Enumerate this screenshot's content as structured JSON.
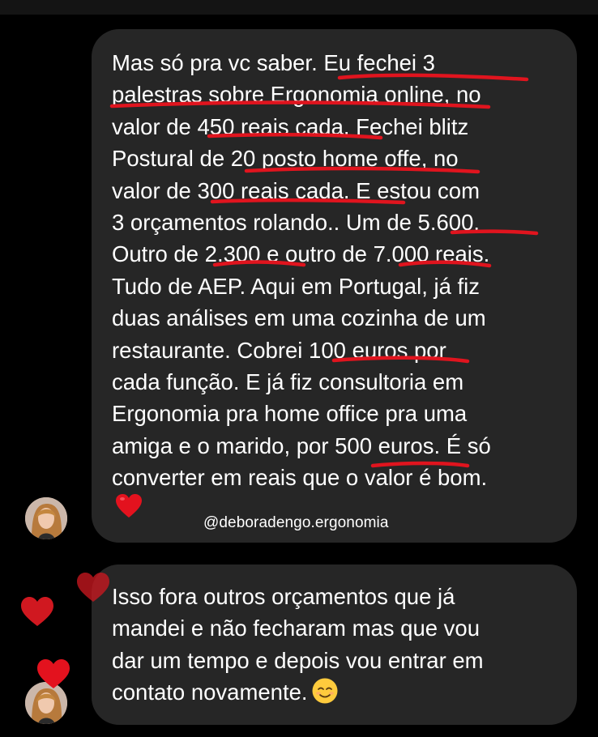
{
  "messages": [
    {
      "lines": [
        "Mas só pra vc saber. Eu fechei 3",
        "palestras sobre Ergonomia online, no",
        "valor de 450 reais cada. Fechei blitz",
        "Postural de 20 posto home offe, no",
        "valor de 300 reais cada. E estou com",
        "3 orçamentos rolando.. Um de 5.600.",
        "Outro de 2.300 e outro de 7.000 reais.",
        "Tudo de AEP. Aqui em Portugal, já fiz",
        "duas análises em uma cozinha de um",
        "restaurante. Cobrei 100 euros por",
        "cada função. E já fiz consultoria em",
        "Ergonomia pra home office pra uma",
        "amiga e o marido, por 500 euros. É só",
        "converter em reais que o valor é bom."
      ],
      "trailing_emoji": "red-heart",
      "watermark": "@deboradengo.ergonomia"
    },
    {
      "lines": [
        "Isso fora outros orçamentos que já",
        "mandei e não fecharam mas que vou",
        "dar um tempo e depois vou entrar em",
        "contato novamente."
      ],
      "trailing_emoji": "relieved-face"
    }
  ],
  "reactions": [
    "red-heart",
    "red-heart",
    "red-heart"
  ],
  "colors": {
    "background": "#000000",
    "bubble": "#262626",
    "text": "#ffffff",
    "underline": "#e0141e",
    "heart": "#d8121c"
  }
}
